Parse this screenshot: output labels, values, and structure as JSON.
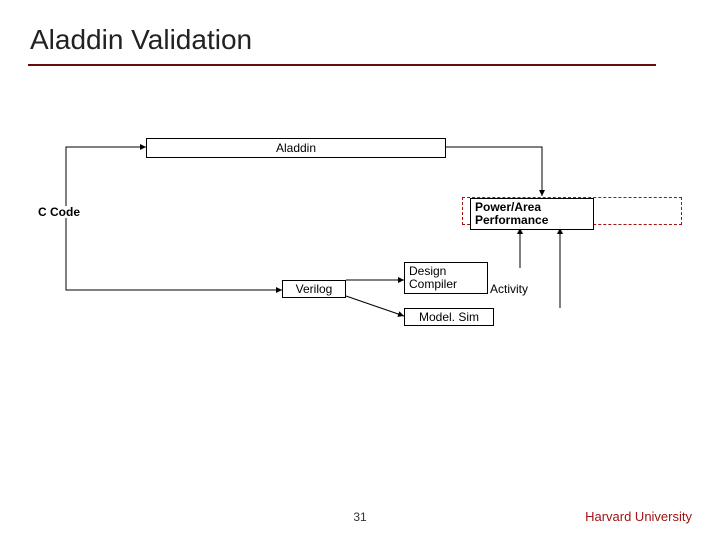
{
  "slide": {
    "title": "Aladdin Validation",
    "page_number": "31",
    "footer": "Harvard University"
  },
  "nodes": {
    "aladdin": "Aladdin",
    "c_code": "C Code",
    "power_area_performance_line1": "Power/Area",
    "power_area_performance_line2": "Performance",
    "verilog": "Verilog",
    "design_compiler_line1": "Design",
    "design_compiler_line2": "Compiler",
    "activity": "Activity",
    "modelsim": "Model. Sim"
  }
}
